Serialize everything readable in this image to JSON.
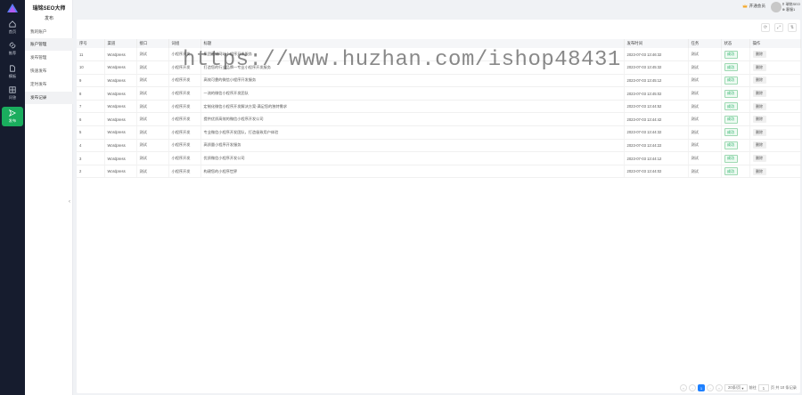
{
  "brand": {
    "title": "瑞铭SEO大师"
  },
  "rail": {
    "items": [
      {
        "label": "首页",
        "icon": "home-icon"
      },
      {
        "label": "推荐",
        "icon": "link-icon"
      },
      {
        "label": "模板",
        "icon": "document-icon"
      },
      {
        "label": "问答",
        "icon": "grid-icon"
      },
      {
        "label": "发布",
        "icon": "send-icon"
      }
    ]
  },
  "submenu": {
    "title": "发布",
    "items": [
      {
        "label": "我的账户"
      },
      {
        "label": "账户管理"
      },
      {
        "label": "发布管理"
      },
      {
        "label": "快速发布"
      },
      {
        "label": "定时发布"
      },
      {
        "label": "发布记录"
      }
    ]
  },
  "topbar": {
    "vip_label": "开通会员",
    "user_name": "瑞铭SEO",
    "user_id": "客服1"
  },
  "toolbar": {
    "refresh": "⟳",
    "fullscreen": "⤢",
    "columns": "⇅"
  },
  "table": {
    "headers": [
      "序号",
      "渠道",
      "接口",
      "词组",
      "标题",
      "发布时间",
      "任务",
      "状态",
      "操作"
    ],
    "rows": [
      [
        "11",
        "Wordpress",
        "测试",
        "小程序开发",
        "集团营销网站小程序开发服务",
        "2023-07-03 13:46:32",
        "测试",
        "成功",
        "删除"
      ],
      [
        "10",
        "Wordpress",
        "测试",
        "小程序开发",
        "打造您的行业品牌—专业小程序开发服务",
        "2023-07-03 13:45:32",
        "测试",
        "成功",
        "删除"
      ],
      [
        "9",
        "Wordpress",
        "测试",
        "小程序开发",
        "高效可靠的微信小程序开发服务",
        "2023-07-03 13:45:12",
        "测试",
        "成功",
        "删除"
      ],
      [
        "8",
        "Wordpress",
        "测试",
        "小程序开发",
        "一流的微信小程序开发团队",
        "2023-07-03 13:45:02",
        "测试",
        "成功",
        "删除"
      ],
      [
        "7",
        "Wordpress",
        "测试",
        "小程序开发",
        "定制化微信小程序开发解决方案-满足您的独特需求",
        "2023-07-03 13:44:52",
        "测试",
        "成功",
        "删除"
      ],
      [
        "6",
        "Wordpress",
        "测试",
        "小程序开发",
        "提供优质高效的微信小程序开发公司",
        "2023-07-03 13:44:42",
        "测试",
        "成功",
        "删除"
      ],
      [
        "5",
        "Wordpress",
        "测试",
        "小程序开发",
        "专业微信小程序开发团队，打造极致用户体验",
        "2023-07-03 13:44:32",
        "测试",
        "成功",
        "删除"
      ],
      [
        "4",
        "Wordpress",
        "测试",
        "小程序开发",
        "高质量小程序开发服务",
        "2023-07-03 13:44:22",
        "测试",
        "成功",
        "删除"
      ],
      [
        "3",
        "Wordpress",
        "测试",
        "小程序开发",
        "优质微信小程序开发公司",
        "2023-07-03 13:44:12",
        "测试",
        "成功",
        "删除"
      ],
      [
        "2",
        "Wordpress",
        "测试",
        "小程序开发",
        "构建您的小程序世界",
        "2023-07-03 13:44:02",
        "测试",
        "成功",
        "删除"
      ]
    ]
  },
  "pagination": {
    "first": "«",
    "prev": "‹",
    "current": "1",
    "next": "›",
    "last": "»",
    "page_size": "20条/页",
    "goto_label": "前往",
    "goto_value": "1",
    "summary": "页 共 10 条记录"
  },
  "watermark": "https://www.huzhan.com/ishop48431",
  "colors": {
    "accent": "#1aad5e",
    "rail_bg": "#161c2e",
    "pager_active": "#1e80ff"
  }
}
